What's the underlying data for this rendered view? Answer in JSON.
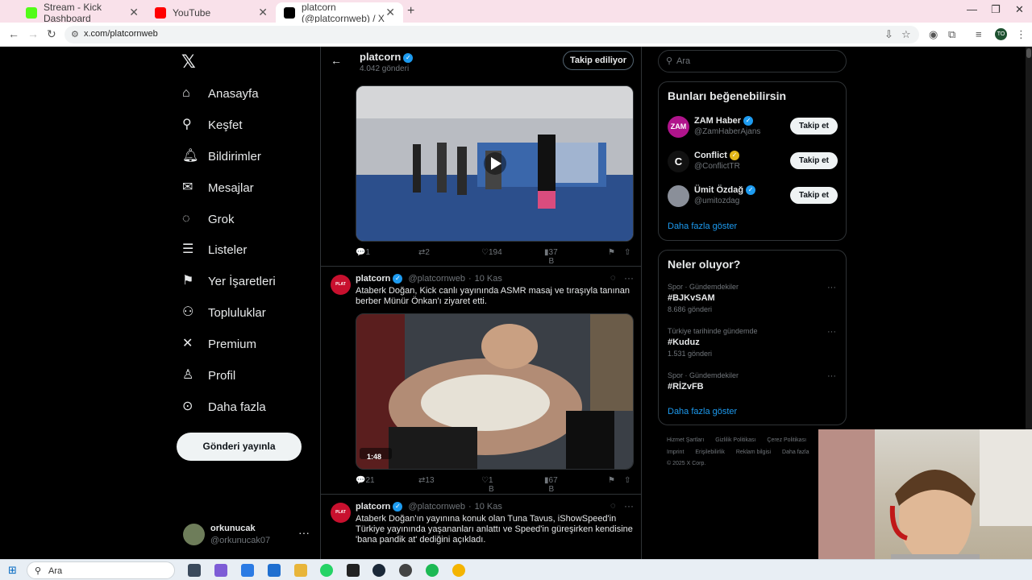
{
  "browser": {
    "tabs": [
      {
        "title": "Stream - Kick Dashboard",
        "color": "#53fc18"
      },
      {
        "title": "YouTube",
        "color": "#ff0000"
      },
      {
        "title": "platcorn (@platcornweb) / X",
        "color": "#000000"
      }
    ],
    "url": "x.com/platcornweb",
    "profile_initials": "TO"
  },
  "nav": {
    "items": [
      {
        "label": "Anasayfa",
        "icon": "home-icon"
      },
      {
        "label": "Keşfet",
        "icon": "search-icon"
      },
      {
        "label": "Bildirimler",
        "icon": "bell-icon"
      },
      {
        "label": "Mesajlar",
        "icon": "mail-icon"
      },
      {
        "label": "Grok",
        "icon": "grok-icon"
      },
      {
        "label": "Listeler",
        "icon": "list-icon"
      },
      {
        "label": "Yer İşaretleri",
        "icon": "bookmark-icon"
      },
      {
        "label": "Topluluklar",
        "icon": "people-icon"
      },
      {
        "label": "Premium",
        "icon": "x-icon"
      },
      {
        "label": "Profil",
        "icon": "person-icon"
      },
      {
        "label": "Daha fazla",
        "icon": "more-circle-icon"
      }
    ],
    "post_button": "Gönderi yayınla",
    "account": {
      "name": "orkunucak",
      "handle": "@orkunucak07"
    }
  },
  "profile_header": {
    "name": "platcorn",
    "post_count": "4.042 gönderi",
    "follow_label": "Takip ediliyor"
  },
  "tweets": [
    {
      "actions": {
        "replies": "1",
        "reposts": "2",
        "likes": "194",
        "views": "37 B"
      }
    },
    {
      "name": "platcorn",
      "handle": "@platcornweb",
      "time": "10 Kas",
      "text": "Ataberk Doğan, Kick canlı yayınında ASMR masaj ve tıraşıyla tanınan berber Münür Önkan'ı ziyaret etti.",
      "duration": "1:48",
      "actions": {
        "replies": "21",
        "reposts": "13",
        "likes": "1 B",
        "views": "67 B"
      }
    },
    {
      "name": "platcorn",
      "handle": "@platcornweb",
      "time": "10 Kas",
      "text": "Ataberk Doğan'ın yayınına konuk olan Tuna Tavus, iShowSpeed'in Türkiye yayınında yaşananları anlattı ve Speed'in güreşirken kendisine 'bana pandik at' dediğini açıkladı."
    }
  ],
  "sidebar": {
    "search_placeholder": "Ara",
    "suggest_title": "Bunları beğenebilirsin",
    "suggestions": [
      {
        "name": "ZAM Haber",
        "handle": "@ZamHaberAjans",
        "follow": "Takip et",
        "color": "#b0148c"
      },
      {
        "name": "Conflict",
        "handle": "@ConflictTR",
        "follow": "Takip et",
        "color": "#111111"
      },
      {
        "name": "Ümit Özdağ",
        "handle": "@umitozdag",
        "follow": "Takip et",
        "color": "#8a8f99"
      }
    ],
    "suggest_more": "Daha fazla göster",
    "trends_title": "Neler oluyor?",
    "trends": [
      {
        "category": "Spor · Gündemdekiler",
        "tag": "#BJKvSAM",
        "count": "8.686 gönderi"
      },
      {
        "category": "Türkiye tarihinde gündemde",
        "tag": "#Kuduz",
        "count": "1.531 gönderi"
      },
      {
        "category": "Spor · Gündemdekiler",
        "tag": "#RİZvFB",
        "count": ""
      }
    ],
    "trends_more": "Daha fazla göster",
    "footer_line1": [
      "Hizmet Şartları",
      "Gizlilik Politikası",
      "Çerez Politikası"
    ],
    "footer_line2": [
      "Imprint",
      "Erişilebilirlik",
      "Reklam bilgisi",
      "Daha fazla"
    ],
    "copyright": "© 2025 X Corp."
  },
  "taskbar": {
    "search_placeholder": "Ara"
  }
}
